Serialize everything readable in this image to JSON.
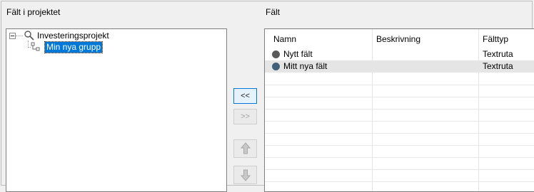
{
  "left_panel": {
    "title": "Fält i projektet",
    "tree": {
      "root_label": "Investeringsprojekt",
      "child_label": "Min nya grupp"
    }
  },
  "buttons": {
    "add_label": "<<",
    "remove_label": ">>"
  },
  "right_panel": {
    "title": "Fält",
    "columns": [
      "Namn",
      "Beskrivning",
      "Fälttyp"
    ],
    "rows": [
      {
        "name": "Nytt fält",
        "description": "",
        "type": "Textruta",
        "dot_color": "#5a5a5a"
      },
      {
        "name": "Mitt nya fält",
        "description": "",
        "type": "Textruta",
        "dot_color": "#3f5f7a"
      }
    ]
  },
  "colors": {
    "selection": "#0078d7",
    "row_selected": "#e5e5e5"
  }
}
